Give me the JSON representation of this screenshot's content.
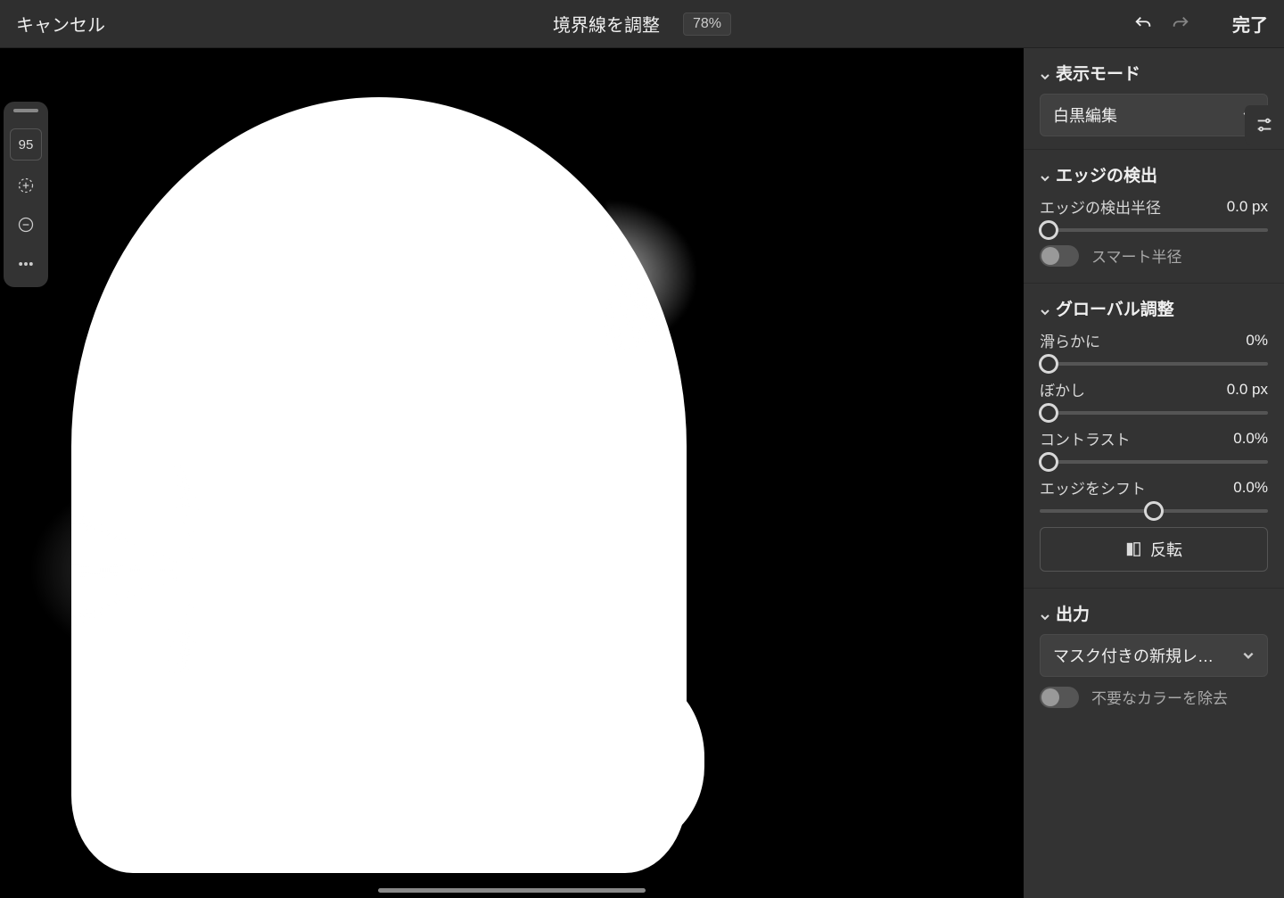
{
  "topbar": {
    "cancel": "キャンセル",
    "title": "境界線を調整",
    "zoom": "78%",
    "done": "完了"
  },
  "toolbar": {
    "brush_size": "95"
  },
  "panel": {
    "view_mode": {
      "title": "表示モード",
      "selected": "白黒編集"
    },
    "edge_detect": {
      "title": "エッジの検出",
      "radius_label": "エッジの検出半径",
      "radius_value": "0.0 px",
      "smart_radius_label": "スマート半径",
      "smart_radius_on": false
    },
    "global": {
      "title": "グローバル調整",
      "smooth_label": "滑らかに",
      "smooth_value": "0%",
      "blur_label": "ぼかし",
      "blur_value": "0.0 px",
      "contrast_label": "コントラスト",
      "contrast_value": "0.0%",
      "shift_label": "エッジをシフト",
      "shift_value": "0.0%",
      "invert_label": "反転"
    },
    "output": {
      "title": "出力",
      "selected": "マスク付きの新規レ…",
      "decontaminate_label": "不要なカラーを除去"
    }
  }
}
